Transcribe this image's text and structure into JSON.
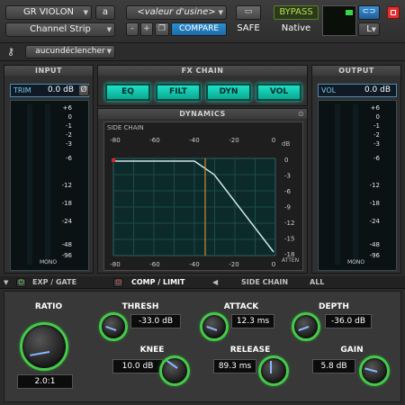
{
  "header": {
    "preset_name": "GR VIOLON",
    "preset_slot": "a",
    "plugin_name": "Channel Strip",
    "factory_preset": "<valeur d'usine>",
    "minus": "-",
    "plus": "+",
    "compare": "COMPARE",
    "safe": "SAFE",
    "bypass": "BYPASS",
    "native": "Native",
    "channel": "L"
  },
  "keybar": {
    "key_selector": "aucundéclencher"
  },
  "input": {
    "title": "INPUT",
    "trim_label": "TRIM",
    "trim_value": "0.0 dB",
    "phase": "Ø",
    "scale": [
      "+6",
      "0",
      "-1",
      "-2",
      "-3",
      "-6",
      "-12",
      "-18",
      "-24",
      "-48",
      "-96"
    ],
    "mono": "MONO"
  },
  "fx_chain": {
    "title": "FX CHAIN",
    "buttons": [
      "EQ",
      "FILT",
      "DYN",
      "VOL"
    ]
  },
  "dynamics": {
    "title": "DYNAMICS",
    "side_chain": "SIDE CHAIN",
    "db": "dB",
    "top_scale": [
      "-80",
      "-60",
      "-40",
      "-20",
      "0"
    ],
    "bottom_scale": [
      "-80",
      "-60",
      "-40",
      "-20",
      "0"
    ],
    "right_scale": [
      "0",
      "-3",
      "-6",
      "-9",
      "-12",
      "-15",
      "-18"
    ],
    "atten": "ATTEN"
  },
  "output": {
    "title": "OUTPUT",
    "vol_label": "VOL",
    "vol_value": "0.0 dB",
    "scale": [
      "+6",
      "0",
      "-1",
      "-2",
      "-3",
      "-6",
      "-12",
      "-18",
      "-24",
      "-48",
      "-96"
    ],
    "mono": "MONO"
  },
  "tabs": {
    "exp_gate": "EXP / GATE",
    "comp_limit": "COMP / LIMIT",
    "side_chain": "SIDE CHAIN",
    "all": "ALL"
  },
  "controls": {
    "ratio": {
      "label": "RATIO",
      "value": "2.0:1"
    },
    "thresh": {
      "label": "THRESH",
      "value": "-33.0 dB"
    },
    "knee": {
      "label": "KNEE",
      "value": "10.0 dB"
    },
    "attack": {
      "label": "ATTACK",
      "value": "12.3 ms"
    },
    "release": {
      "label": "RELEASE",
      "value": "89.3 ms"
    },
    "depth": {
      "label": "DEPTH",
      "value": "-36.0 dB"
    },
    "gain": {
      "label": "GAIN",
      "value": "5.8 dB"
    }
  },
  "colors": {
    "accent_teal": "#1fe0c8",
    "compare_blue": "#2d8fd0",
    "bypass_green": "#b3e04a",
    "knob_ring": "#46c94a",
    "power_red": "#e23030"
  }
}
